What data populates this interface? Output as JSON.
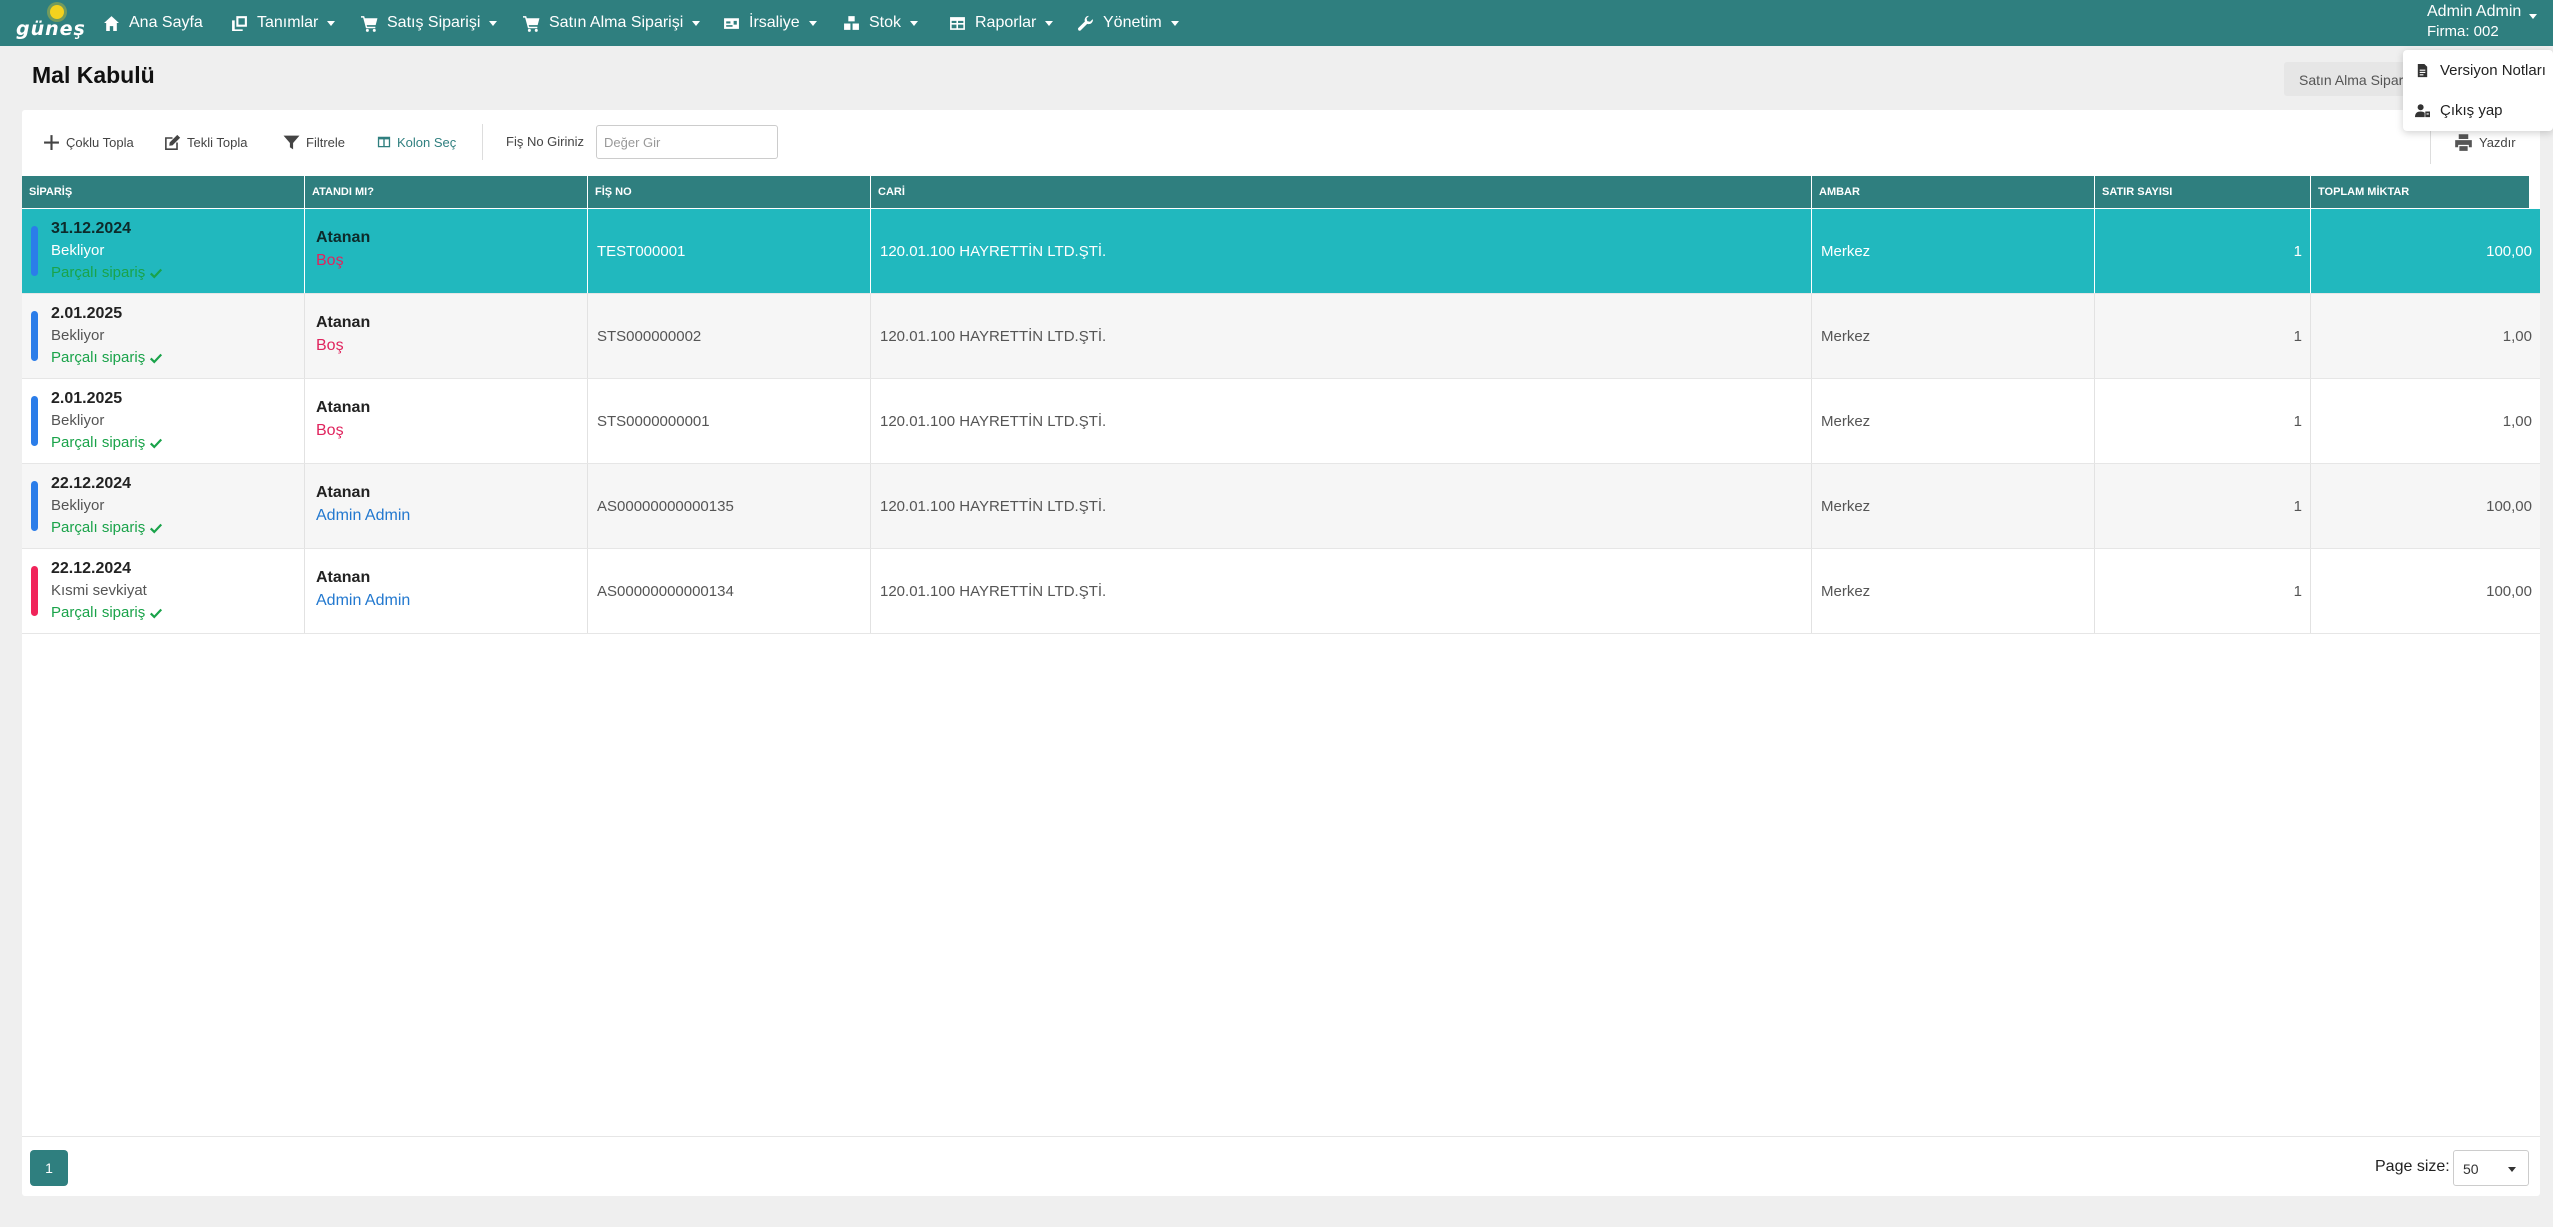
{
  "app": {
    "logo_text": "güneş"
  },
  "nav": {
    "items": [
      {
        "label": "Ana Sayfa",
        "icon": "home-icon",
        "dropdown": false
      },
      {
        "label": "Tanımlar",
        "icon": "clone-icon",
        "dropdown": true
      },
      {
        "label": "Satış Siparişi",
        "icon": "cart-icon",
        "dropdown": true
      },
      {
        "label": "Satın Alma Siparişi",
        "icon": "cart-icon",
        "dropdown": true
      },
      {
        "label": "İrsaliye",
        "icon": "id-card-icon",
        "dropdown": true
      },
      {
        "label": "Stok",
        "icon": "cubes-icon",
        "dropdown": true
      },
      {
        "label": "Raporlar",
        "icon": "table-icon",
        "dropdown": true
      },
      {
        "label": "Yönetim",
        "icon": "wrench-icon",
        "dropdown": true
      }
    ]
  },
  "user": {
    "name": "Admin Admin",
    "firma": "Firma: 002"
  },
  "user_menu": {
    "items": [
      {
        "label": "Versiyon Notları",
        "icon": "file-icon"
      },
      {
        "label": "Çıkış yap",
        "icon": "user-logout-icon"
      }
    ]
  },
  "page": {
    "title": "Mal Kabulü",
    "crumb": "Satın Alma Siparişi"
  },
  "toolbar": {
    "coklu": "Çoklu Topla",
    "tekli": "Tekli Topla",
    "filtrele": "Filtrele",
    "kolon": "Kolon Seç",
    "fis_label": "Fiş No Giriniz",
    "fis_placeholder": "Değer Gir",
    "yazdir": "Yazdır"
  },
  "table": {
    "columns": [
      "SİPARİŞ",
      "ATANDI MI?",
      "FİŞ NO",
      "CARİ",
      "AMBAR",
      "SATIR SAYISI",
      "TOPLAM MİKTAR"
    ],
    "rows": [
      {
        "date": "31.12.2024",
        "status": "Bekliyor",
        "part": "Parçalı sipariş",
        "status_color": "#2b7de9",
        "atanan": "Atanan",
        "assignee": "Boş",
        "assignee_type": "bos",
        "fis_no": "TEST000001",
        "cari": "120.01.100 HAYRETTİN LTD.ŞTİ.",
        "ambar": "Merkez",
        "satir": "1",
        "miktar": "100,00",
        "selected": true
      },
      {
        "date": "2.01.2025",
        "status": "Bekliyor",
        "part": "Parçalı sipariş",
        "status_color": "#2b7de9",
        "atanan": "Atanan",
        "assignee": "Boş",
        "assignee_type": "bos",
        "fis_no": "STS000000002",
        "cari": "120.01.100 HAYRETTİN LTD.ŞTİ.",
        "ambar": "Merkez",
        "satir": "1",
        "miktar": "1,00",
        "selected": false
      },
      {
        "date": "2.01.2025",
        "status": "Bekliyor",
        "part": "Parçalı sipariş",
        "status_color": "#2b7de9",
        "atanan": "Atanan",
        "assignee": "Boş",
        "assignee_type": "bos",
        "fis_no": "STS0000000001",
        "cari": "120.01.100 HAYRETTİN LTD.ŞTİ.",
        "ambar": "Merkez",
        "satir": "1",
        "miktar": "1,00",
        "selected": false
      },
      {
        "date": "22.12.2024",
        "status": "Bekliyor",
        "part": "Parçalı sipariş",
        "status_color": "#2b7de9",
        "atanan": "Atanan",
        "assignee": "Admin Admin",
        "assignee_type": "user",
        "fis_no": "AS00000000000135",
        "cari": "120.01.100 HAYRETTİN LTD.ŞTİ.",
        "ambar": "Merkez",
        "satir": "1",
        "miktar": "100,00",
        "selected": false
      },
      {
        "date": "22.12.2024",
        "status": "Kısmi sevkiyat",
        "part": "Parçalı sipariş",
        "status_color": "#f0245a",
        "atanan": "Atanan",
        "assignee": "Admin Admin",
        "assignee_type": "user",
        "fis_no": "AS00000000000134",
        "cari": "120.01.100 HAYRETTİN LTD.ŞTİ.",
        "ambar": "Merkez",
        "satir": "1",
        "miktar": "100,00",
        "selected": false
      }
    ]
  },
  "pagination": {
    "current": "1",
    "page_size_label": "Page size:",
    "page_size": "50"
  },
  "colors": {
    "primary": "#2f7f7f",
    "selected_row": "#21b8be",
    "success": "#1aa34a",
    "danger": "#e0245e",
    "link": "#2278cf"
  }
}
